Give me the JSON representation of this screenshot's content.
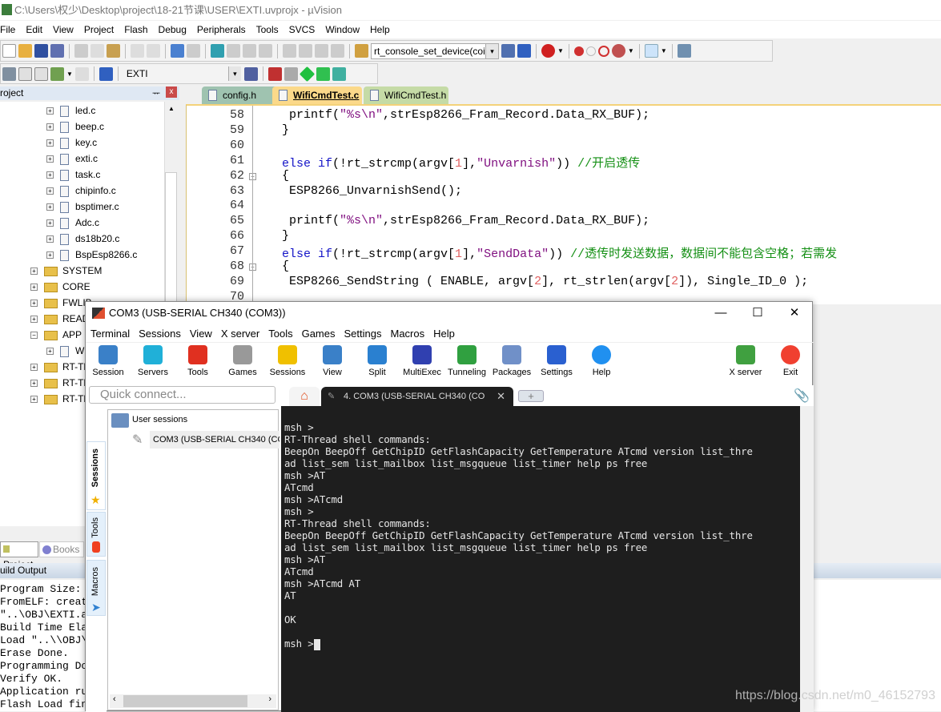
{
  "uvision": {
    "title": "C:\\Users\\权少\\Desktop\\project\\18-21节课\\USER\\EXTI.uvprojx - µVision",
    "menu": [
      "File",
      "Edit",
      "View",
      "Project",
      "Flash",
      "Debug",
      "Peripherals",
      "Tools",
      "SVCS",
      "Window",
      "Help"
    ],
    "find_combo": "rt_console_set_device(coi",
    "target_combo": "EXTI",
    "project_panel_title": "roject",
    "tree": {
      "files": [
        "led.c",
        "beep.c",
        "key.c",
        "exti.c",
        "task.c",
        "chipinfo.c",
        "bsptimer.c",
        "Adc.c",
        "ds18b20.c",
        "BspEsp8266.c"
      ],
      "groups": [
        "SYSTEM",
        "CORE",
        "FWLIB",
        "READI",
        "APP",
        "W",
        "RT-Thr",
        "RT-Thr",
        "RT-Thr"
      ]
    },
    "editor_tabs": [
      "config.h",
      "WifiCmdTest.c",
      "WifiCmdTest.h"
    ],
    "active_tab": "WifiCmdTest.c",
    "code": [
      {
        "n": "58",
        "tokens": [
          [
            "  printf(",
            ""
          ],
          [
            "\"%s\\n\"",
            "str"
          ],
          [
            ",strEsp8266_Fram_Record.Data_RX_BUF);",
            ""
          ]
        ]
      },
      {
        "n": "59",
        "tokens": [
          [
            " }",
            ""
          ]
        ]
      },
      {
        "n": "60",
        "tokens": []
      },
      {
        "n": "61",
        "tokens": [
          [
            " else if",
            "kw"
          ],
          [
            "(!rt_strcmp(argv[",
            ""
          ],
          [
            "1",
            "num"
          ],
          [
            "],",
            ""
          ],
          [
            "\"Unvarnish\"",
            "str"
          ],
          [
            ")) ",
            ""
          ],
          [
            "//开启透传",
            "cm"
          ]
        ]
      },
      {
        "n": "62",
        "tokens": [
          [
            " {",
            ""
          ]
        ]
      },
      {
        "n": "63",
        "tokens": [
          [
            "  ESP8266_UnvarnishSend();",
            ""
          ]
        ]
      },
      {
        "n": "64",
        "tokens": []
      },
      {
        "n": "65",
        "tokens": [
          [
            "  printf(",
            ""
          ],
          [
            "\"%s\\n\"",
            "str"
          ],
          [
            ",strEsp8266_Fram_Record.Data_RX_BUF);",
            ""
          ]
        ]
      },
      {
        "n": "66",
        "tokens": [
          [
            " }",
            ""
          ]
        ]
      },
      {
        "n": "67",
        "tokens": [
          [
            " else if",
            "kw"
          ],
          [
            "(!rt_strcmp(argv[",
            ""
          ],
          [
            "1",
            "num"
          ],
          [
            "],",
            ""
          ],
          [
            "\"SendData\"",
            "str"
          ],
          [
            ")) ",
            ""
          ],
          [
            "//透传时发送数据，数据间不能包含空格；若需发",
            "cm"
          ]
        ]
      },
      {
        "n": "68",
        "tokens": [
          [
            " {",
            ""
          ]
        ]
      },
      {
        "n": "69",
        "tokens": [
          [
            "  ESP8266_SendString ( ENABLE, argv[",
            ""
          ],
          [
            "2",
            "num"
          ],
          [
            "], rt_strlen(argv[",
            ""
          ],
          [
            "2",
            "num"
          ],
          [
            "]), Single_ID_0 );",
            ""
          ]
        ]
      },
      {
        "n": "70",
        "tokens": []
      }
    ],
    "bottom_tabs": [
      "Project",
      "Books"
    ],
    "build_output_title": "uild Output",
    "build_output": [
      "Program Size:",
      "FromELF: creat",
      "\"..\\OBJ\\EXTI.a",
      "Build Time Ela",
      "Load \"..\\\\OBJ\\",
      "Erase Done.",
      "Programming Do",
      "Verify OK.",
      "Application ru",
      "Flash Load fin"
    ]
  },
  "moba": {
    "title": "COM3  (USB-SERIAL CH340 (COM3))",
    "menu": [
      "Terminal",
      "Sessions",
      "View",
      "X server",
      "Tools",
      "Games",
      "Settings",
      "Macros",
      "Help"
    ],
    "toolbar": [
      {
        "label": "Session",
        "icon": "monitor-session-icon",
        "color": "#3a80c8"
      },
      {
        "label": "Servers",
        "icon": "servers-icon",
        "color": "#20b0d8"
      },
      {
        "label": "Tools",
        "icon": "swiss-knife-icon",
        "color": "#e03020"
      },
      {
        "label": "Games",
        "icon": "gamepad-icon",
        "color": "#999999"
      },
      {
        "label": "Sessions",
        "icon": "star-icon",
        "color": "#f0c000"
      },
      {
        "label": "View",
        "icon": "view-monitor-icon",
        "color": "#3a80c8"
      },
      {
        "label": "Split",
        "icon": "split-icon",
        "color": "#2a80d0"
      },
      {
        "label": "MultiExec",
        "icon": "multiexec-fork-icon",
        "color": "#3040b0"
      },
      {
        "label": "Tunneling",
        "icon": "tunneling-icon",
        "color": "#30a040"
      },
      {
        "label": "Packages",
        "icon": "packages-icon",
        "color": "#7090c8"
      },
      {
        "label": "Settings",
        "icon": "gears-icon",
        "color": "#2a60d0"
      },
      {
        "label": "Help",
        "icon": "help-icon",
        "color": "#2090f0"
      },
      {
        "label": "X server",
        "icon": "x-server-icon",
        "color": "#40a040"
      },
      {
        "label": "Exit",
        "icon": "power-icon",
        "color": "#f04030"
      }
    ],
    "quick_connect_placeholder": "Quick connect...",
    "tab_label": "4. COM3  (USB-SERIAL CH340 (CO",
    "vertical_tabs": [
      "Sessions",
      "Tools",
      "Macros"
    ],
    "sessions_root": "User sessions",
    "session_item": "COM3  (USB-SERIAL CH340 (CC",
    "terminal": [
      "msh >",
      "RT-Thread shell commands:",
      "BeepOn BeepOff GetChipID GetFlashCapacity GetTemperature ATcmd version list_thre",
      "ad list_sem list_mailbox list_msgqueue list_timer help ps free",
      "msh >AT",
      "ATcmd",
      "msh >ATcmd",
      "msh >",
      "RT-Thread shell commands:",
      "BeepOn BeepOff GetChipID GetFlashCapacity GetTemperature ATcmd version list_thre",
      "ad list_sem list_mailbox list_msgqueue list_timer help ps free",
      "msh >AT",
      "ATcmd",
      "msh >ATcmd AT",
      "AT",
      "",
      "OK",
      "",
      "msh >"
    ]
  },
  "watermark": "https://blog.csdn.net/m0_46152793"
}
